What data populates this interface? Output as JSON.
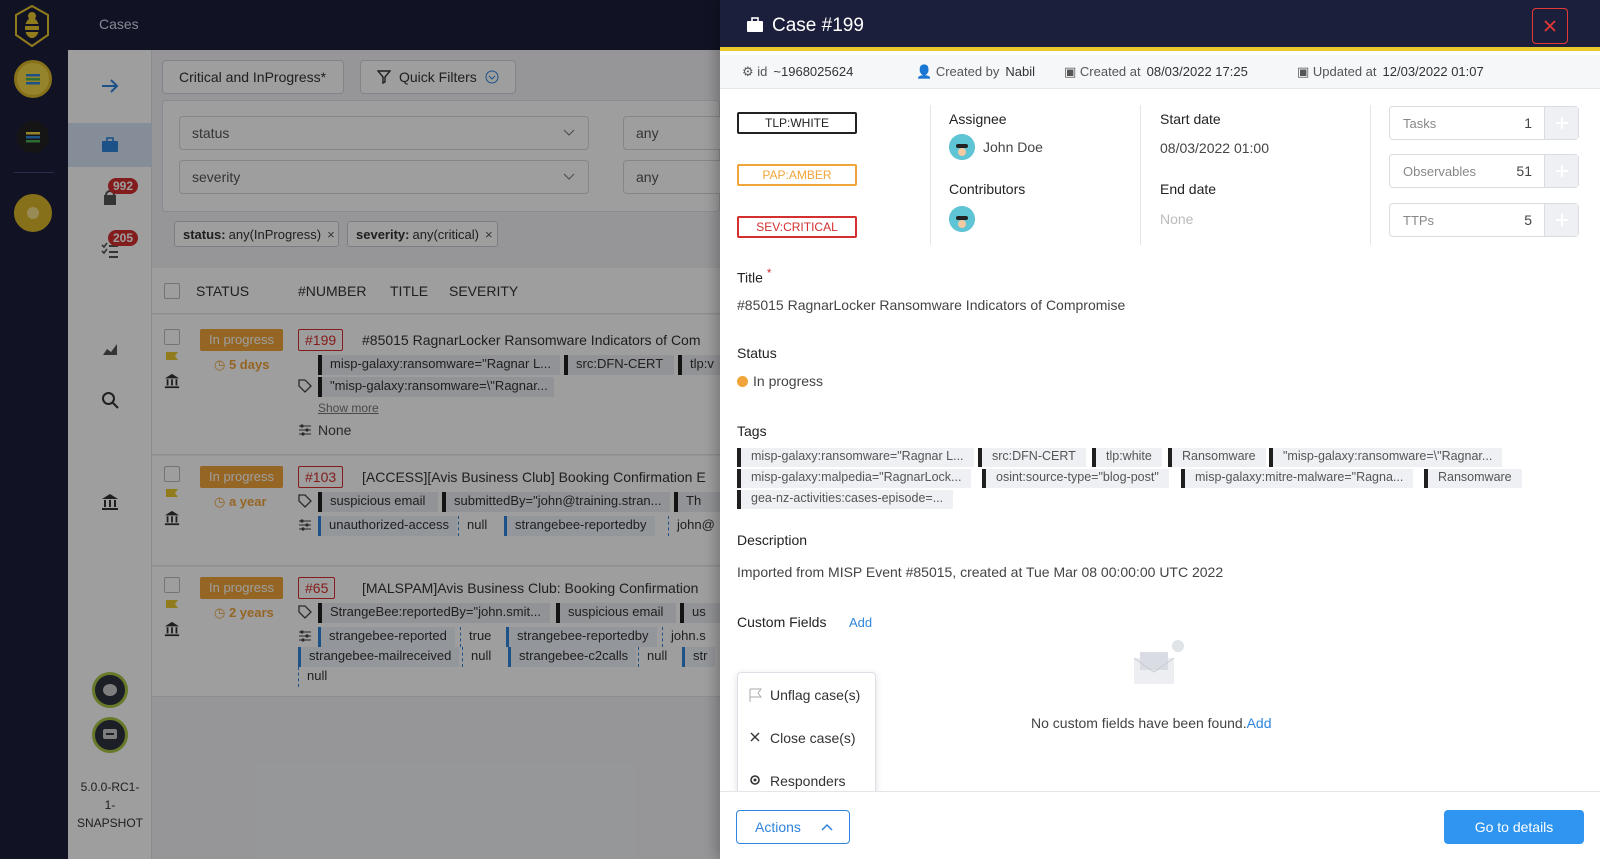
{
  "header": {
    "breadcrumb": "Cases"
  },
  "nav": {
    "alerts_badge": "992",
    "tasks_badge": "205",
    "version": "5.0.0-RC1-\n1-\nSNAPSHOT",
    "version_lines": [
      "5.0.0-RC1-",
      "1-",
      "SNAPSHOT"
    ]
  },
  "list": {
    "saved_filter": "Critical and InProgress*",
    "quick_filters": "Quick Filters",
    "filters": [
      {
        "field": "status",
        "operator": "any"
      },
      {
        "field": "severity",
        "operator": "any"
      }
    ],
    "active_filters": [
      {
        "key": "status:",
        "value": " any(InProgress)"
      },
      {
        "key": "severity:",
        "value": " any(critical)"
      }
    ],
    "columns": [
      "STATUS",
      "#NUMBER",
      "TITLE",
      "SEVERITY"
    ],
    "rows": [
      {
        "status": "In progress",
        "since": "5 days",
        "number": "#199",
        "title": "#85015 RagnarLocker Ransomware Indicators of Com",
        "tags_row1": [
          "misp-galaxy:ransomware=\"Ragnar L...",
          "src:DFN-CERT",
          "tlp:v"
        ],
        "tags_row2": [
          "\"misp-galaxy:ransomware=\\\"Ragnar..."
        ],
        "show_more": "Show more",
        "custom_fields": "None"
      },
      {
        "status": "In progress",
        "since": "a year",
        "number": "#103",
        "title": "[ACCESS][Avis Business Club] Booking Confirmation E",
        "tags_row1": [
          "suspicious email",
          "submittedBy=\"john@training.stran...",
          "Th"
        ],
        "cf_row1": [
          "unauthorized-access",
          "null",
          "strangebee-reportedby",
          "john@"
        ]
      },
      {
        "status": "In progress",
        "since": "2 years",
        "number": "#65",
        "title": "[MALSPAM]Avis Business Club: Booking Confirmation",
        "tags_row1": [
          "StrangeBee:reportedBy=\"john.smit...",
          "suspicious email",
          "us"
        ],
        "cf_row1": [
          "strangebee-reported",
          "true",
          "strangebee-reportedby",
          "john.s"
        ],
        "cf_row2": [
          "strangebee-mailreceived",
          "null",
          "strangebee-c2calls",
          "null",
          "str"
        ],
        "cf_row3": [
          "null"
        ]
      }
    ]
  },
  "drawer": {
    "title": "Case #199",
    "meta": {
      "id_label": "id",
      "id_value": "~1968025624",
      "created_by_label": "Created by",
      "created_by_value": "Nabil",
      "created_at_label": "Created at",
      "created_at_value": "08/03/2022 17:25",
      "updated_at_label": "Updated at",
      "updated_at_value": "12/03/2022 01:07"
    },
    "labels": {
      "tlp": "TLP:WHITE",
      "pap": "PAP:AMBER",
      "sev": "SEV:CRITICAL"
    },
    "assignee_label": "Assignee",
    "assignee_value": "John Doe",
    "contributors_label": "Contributors",
    "start_date_label": "Start date",
    "start_date_value": "08/03/2022 01:00",
    "end_date_label": "End date",
    "end_date_value": "None",
    "counters": [
      {
        "name": "Tasks",
        "value": "1"
      },
      {
        "name": "Observables",
        "value": "51"
      },
      {
        "name": "TTPs",
        "value": "5"
      }
    ],
    "title_label": "Title",
    "required_mark": "*",
    "title_value": "#85015 RagnarLocker Ransomware Indicators of Compromise",
    "status_label": "Status",
    "status_value": "In progress",
    "tags_label": "Tags",
    "tags": [
      "misp-galaxy:ransomware=\"Ragnar L...",
      "src:DFN-CERT",
      "tlp:white",
      "Ransomware",
      "\"misp-galaxy:ransomware=\\\"Ragnar...",
      "misp-galaxy:malpedia=\"RagnarLock...",
      "osint:source-type=\"blog-post\"",
      "misp-galaxy:mitre-malware=\"Ragna...",
      "Ransomware",
      "gea-nz-activities:cases-episode=..."
    ],
    "description_label": "Description",
    "description_value": "Imported from MISP Event #85015, created at Tue Mar 08 00:00:00 UTC 2022",
    "custom_fields_label": "Custom Fields",
    "custom_fields_add": "Add",
    "empty_text": "No custom fields have been found.",
    "empty_add": "Add",
    "menu": [
      "Unflag case(s)",
      "Close case(s)",
      "Responders"
    ],
    "actions_label": "Actions",
    "details_label": "Go to details"
  },
  "colors": {
    "navy": "#1c1f3b",
    "accent": "#2f85de",
    "gold": "#e8c92e",
    "danger": "#d32f2f",
    "progress": "#f0a43a"
  }
}
